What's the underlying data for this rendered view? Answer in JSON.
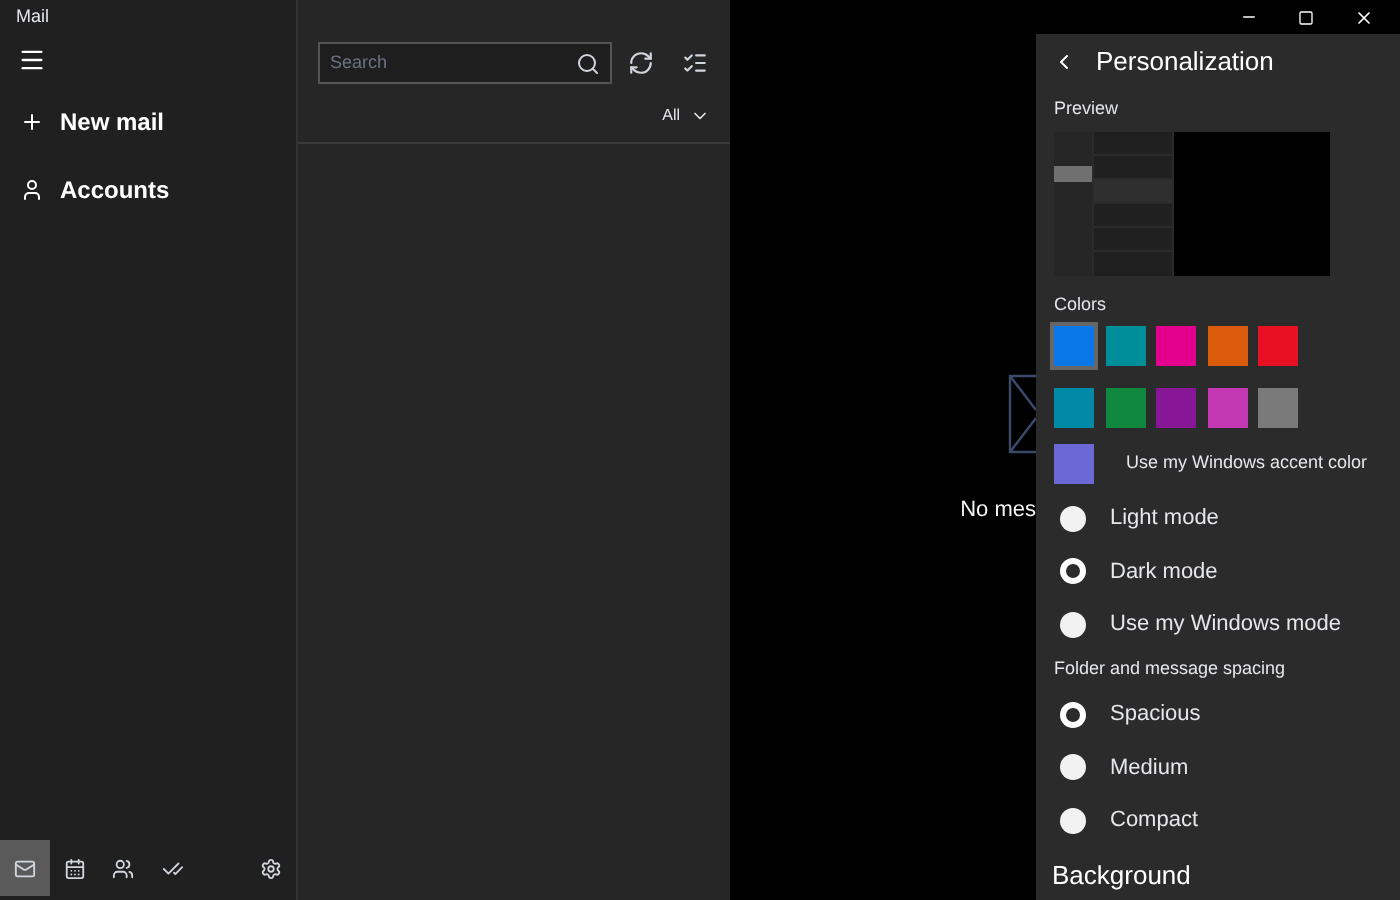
{
  "window": {
    "title": "Mail"
  },
  "sidebar": {
    "items": [
      {
        "label": "New mail",
        "kind": "plus"
      },
      {
        "label": "Accounts",
        "kind": "person"
      }
    ],
    "bottom_nav": [
      {
        "kind": "mail",
        "selected": true
      },
      {
        "kind": "calendar",
        "selected": false
      },
      {
        "kind": "people",
        "selected": false
      },
      {
        "kind": "todo",
        "selected": false
      },
      {
        "kind": "settings",
        "selected": false
      }
    ]
  },
  "message_list": {
    "search": {
      "placeholder": "Search"
    },
    "filter": "All"
  },
  "reading_pane": {
    "message": "No mes"
  },
  "personalization": {
    "title": "Personalization",
    "preview_label": "Preview",
    "colors_label": "Colors",
    "colors": [
      {
        "color": "#0a78e8",
        "selected": true
      },
      {
        "color": "#008f9a",
        "selected": false
      },
      {
        "color": "#e3008c",
        "selected": false
      },
      {
        "color": "#da5b0b",
        "selected": false
      },
      {
        "color": "#e81123",
        "selected": false
      },
      {
        "color": "#0089a6",
        "selected": false
      },
      {
        "color": "#10893e",
        "selected": false
      },
      {
        "color": "#881798",
        "selected": false
      },
      {
        "color": "#c239b3",
        "selected": false
      },
      {
        "color": "#7a7a7a",
        "selected": false
      }
    ],
    "accent": {
      "color": "#6b69d6",
      "label": "Use my Windows accent color"
    },
    "modes": [
      {
        "label": "Light mode",
        "selected": false
      },
      {
        "label": "Dark mode",
        "selected": true
      },
      {
        "label": "Use my Windows mode",
        "selected": false
      }
    ],
    "spacing_label": "Folder and message spacing",
    "spacing": [
      {
        "label": "Spacious",
        "selected": true
      },
      {
        "label": "Medium",
        "selected": false
      },
      {
        "label": "Compact",
        "selected": false
      }
    ],
    "background_label": "Background"
  }
}
